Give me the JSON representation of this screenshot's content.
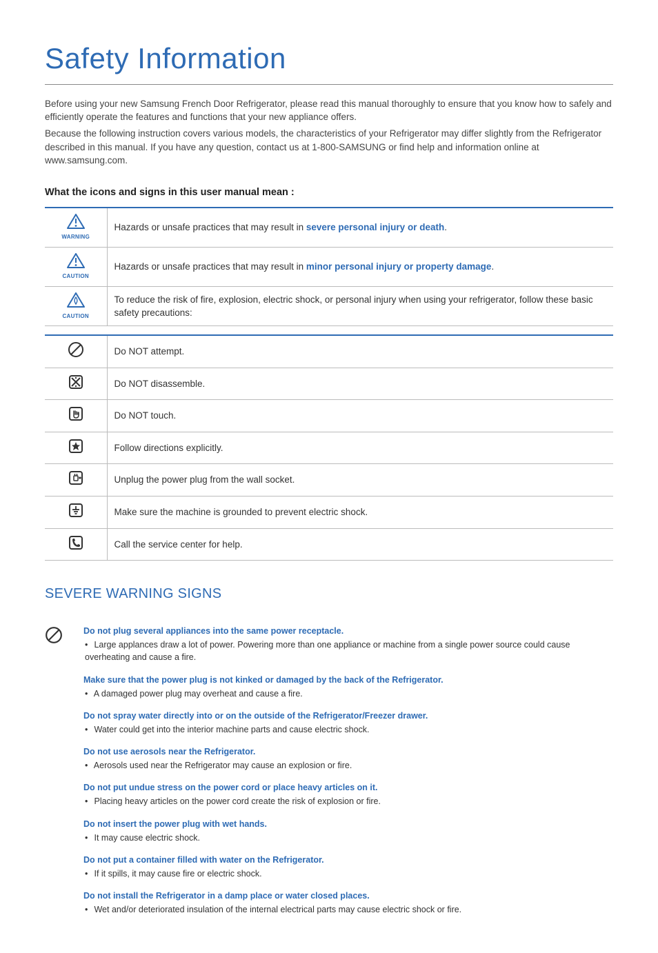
{
  "title": "Safety Information",
  "intro": {
    "p1": "Before using your new Samsung French Door Refrigerator, please read this manual thoroughly to ensure that you know how to safely and efficiently operate the features and functions that your new appliance offers.",
    "p2": "Because the following instruction covers various models, the characteristics of your Refrigerator may differ slightly from the Refrigerator described in this manual. If you have any question, contact us at 1-800-SAMSUNG or find help and information online at www.samsung.com."
  },
  "subheading": "What the icons and signs in this user manual mean :",
  "table1": [
    {
      "iconLabel": "WARNING",
      "pre": "Hazards or unsafe practices that may result in ",
      "bold": "severe personal injury or death",
      "post": "."
    },
    {
      "iconLabel": "CAUTION",
      "pre": "Hazards or unsafe practices that may result in ",
      "bold": "minor personal injury or property damage",
      "post": "."
    },
    {
      "iconLabel": "CAUTION",
      "pre": "To reduce the risk of fire, explosion, electric shock, or personal injury when using your refrigerator, follow these basic safety precautions:",
      "bold": "",
      "post": ""
    }
  ],
  "table2": [
    {
      "text": "Do NOT attempt."
    },
    {
      "text": "Do NOT disassemble."
    },
    {
      "text": "Do NOT touch."
    },
    {
      "text": "Follow directions explicitly."
    },
    {
      "text": "Unplug the power plug from the wall socket."
    },
    {
      "text": "Make sure the machine is grounded to prevent electric shock."
    },
    {
      "text": "Call the service center for help."
    }
  ],
  "sectionHeading": "SEVERE WARNING SIGNS",
  "warnings": [
    {
      "head": "Do not plug several appliances into the same power receptacle.",
      "body": "Large applances draw a lot of power.  Powering more than one appliance or machine from a single power source could cause overheating and cause a fire."
    },
    {
      "head": "Make sure that the power plug is not kinked or damaged by the back of the Refrigerator.",
      "body": "A damaged power plug may overheat and cause a fire."
    },
    {
      "head": "Do not spray water directly into or on the outside of the Refrigerator/Freezer drawer.",
      "body": "Water could get into the interior machine parts and cause electric shock."
    },
    {
      "head": "Do not use aerosols near the Refrigerator.",
      "body": "Aerosols used near the Refrigerator may cause an explosion or fire."
    },
    {
      "head": "Do not put undue stress on the power cord or place heavy articles on it.",
      "body": "Placing heavy articles on the power cord create the risk of explosion or fire."
    },
    {
      "head": "Do not insert the power plug with wet hands.",
      "body": "It may cause electric shock."
    },
    {
      "head": "Do not put a container filled with water on the Refrigerator.",
      "body": "If it spills, it may cause fire or electric shock."
    },
    {
      "head": "Do not install the Refrigerator in a damp place or water closed places.",
      "body": "Wet and/or deteriorated insulation of the internal electrical parts may cause electric shock or fire."
    }
  ]
}
